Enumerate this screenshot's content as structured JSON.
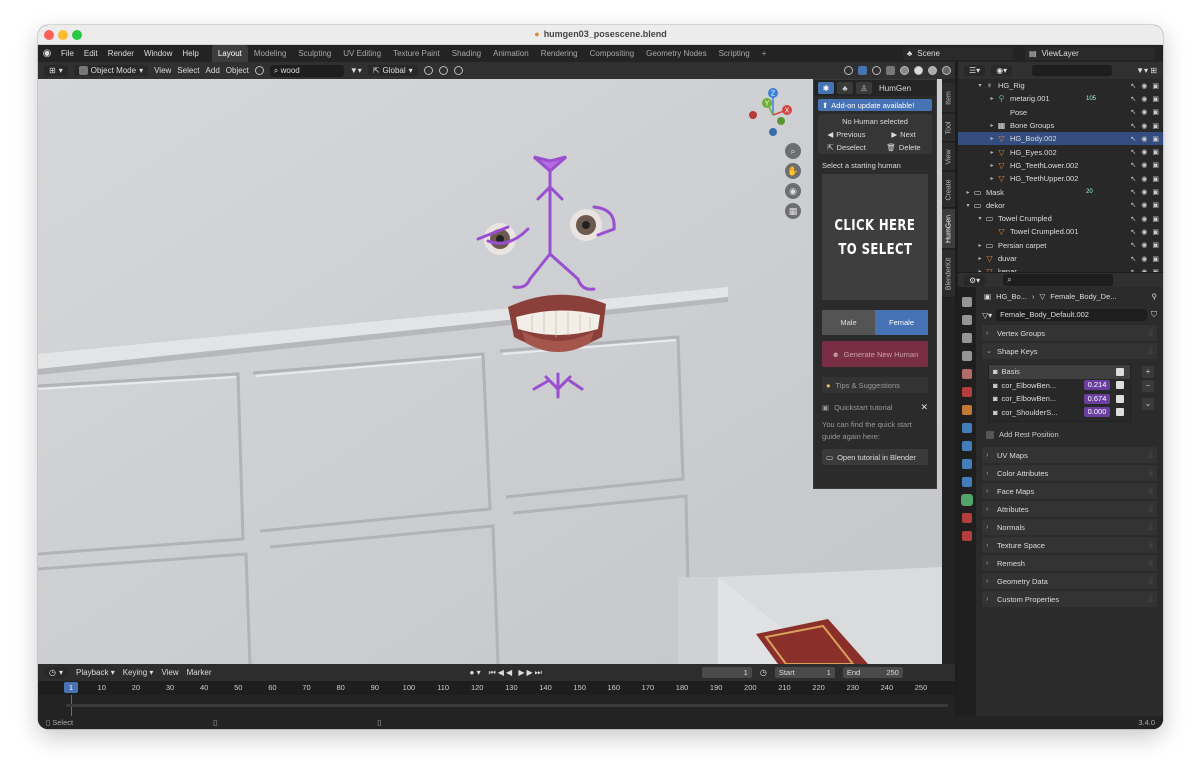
{
  "window": {
    "title": "humgen03_posescene.blend"
  },
  "menu": [
    "File",
    "Edit",
    "Render",
    "Window",
    "Help"
  ],
  "workspaces": [
    {
      "label": "Layout",
      "active": true
    },
    {
      "label": "Modeling"
    },
    {
      "label": "Sculpting"
    },
    {
      "label": "UV Editing"
    },
    {
      "label": "Texture Paint"
    },
    {
      "label": "Shading"
    },
    {
      "label": "Animation"
    },
    {
      "label": "Rendering"
    },
    {
      "label": "Compositing"
    },
    {
      "label": "Geometry Nodes"
    },
    {
      "label": "Scripting"
    },
    {
      "label": "+"
    }
  ],
  "scene": "Scene",
  "view_layer": "ViewLayer",
  "viewport_header": {
    "mode": "Object Mode",
    "items": [
      "View",
      "Select",
      "Add",
      "Object"
    ],
    "search_value": "wood",
    "transform": "Global"
  },
  "gizmo": {
    "x": "X",
    "y": "Y",
    "z": "Z"
  },
  "humgen": {
    "tab_title": "HumGen",
    "update_notice": "Add-on update available!",
    "status": "No Human selected",
    "previous": "Previous",
    "next": "Next",
    "deselect": "Deselect",
    "delete": "Delete",
    "select_label": "Select a starting human",
    "click_line1": "CLICK HERE",
    "click_line2": "TO SELECT",
    "male": "Male",
    "female": "Female",
    "generate": "Generate New Human",
    "tips": "Tips & Suggestions",
    "quickstart_title": "Quickstart tutorial",
    "quickstart_text1": "You can find the quick start",
    "quickstart_text2": "guide again here:",
    "open_tutorial": "Open tutorial in Blender"
  },
  "side_tabs": [
    "Item",
    "Tool",
    "View",
    "Create",
    "HumGen",
    "BlenderKit"
  ],
  "timeline": {
    "menus": [
      "Playback",
      "Keying",
      "View",
      "Marker"
    ],
    "current_frame": "1",
    "start_label": "Start",
    "start": "1",
    "end_label": "End",
    "end": "250",
    "ticks": [
      "1",
      "10",
      "20",
      "30",
      "40",
      "50",
      "60",
      "70",
      "80",
      "90",
      "100",
      "110",
      "120",
      "130",
      "140",
      "150",
      "160",
      "170",
      "180",
      "190",
      "200",
      "210",
      "220",
      "230",
      "240",
      "250"
    ]
  },
  "status_bar": {
    "left": "Select",
    "version": "3.4.0"
  },
  "outliner": [
    {
      "name": "HG_Rig",
      "icon": "armature-icon",
      "indent": 1,
      "arrow": "▾"
    },
    {
      "name": "metarig.001",
      "icon": "bone-icon",
      "indent": 2,
      "arrow": "▸",
      "badge": "105"
    },
    {
      "name": "Pose",
      "icon": "pose-icon",
      "indent": 2,
      "arrow": ""
    },
    {
      "name": "Bone Groups",
      "icon": "group-icon",
      "indent": 2,
      "arrow": "▸"
    },
    {
      "name": "HG_Body.002",
      "icon": "mesh-icon",
      "indent": 2,
      "arrow": "▸",
      "selected": true
    },
    {
      "name": "HG_Eyes.002",
      "icon": "mesh-icon",
      "indent": 2,
      "arrow": "▸"
    },
    {
      "name": "HG_TeethLower.002",
      "icon": "mesh-icon",
      "indent": 2,
      "arrow": "▸"
    },
    {
      "name": "HG_TeethUpper.002",
      "icon": "mesh-icon",
      "indent": 2,
      "arrow": "▸"
    },
    {
      "name": "Mask",
      "icon": "collection-icon",
      "indent": 0,
      "arrow": "▸",
      "badge": "20"
    },
    {
      "name": "dekor",
      "icon": "collection-icon",
      "indent": 0,
      "arrow": "▾"
    },
    {
      "name": "Towel Crumpled",
      "icon": "collection-icon",
      "indent": 1,
      "arrow": "▾"
    },
    {
      "name": "Towel Crumpled.001",
      "icon": "mesh-icon",
      "indent": 2,
      "arrow": ""
    },
    {
      "name": "Persian carpet",
      "icon": "collection-icon",
      "indent": 1,
      "arrow": "▸"
    },
    {
      "name": "duvar",
      "icon": "mesh-icon",
      "indent": 1,
      "arrow": "▸"
    },
    {
      "name": "kenar",
      "icon": "mesh-icon",
      "indent": 1,
      "arrow": "▸"
    }
  ],
  "properties": {
    "breadcrumb_object": "HG_Bo...",
    "breadcrumb_data": "Female_Body_De...",
    "data_name": "Female_Body_Default.002",
    "panels_top": [
      "Vertex Groups",
      "Shape Keys"
    ],
    "shape_keys": [
      {
        "name": "Basis",
        "value": ""
      },
      {
        "name": "cor_ElbowBen...",
        "value": "0.214"
      },
      {
        "name": "cor_ElbowBen...",
        "value": "0.674"
      },
      {
        "name": "cor_ShoulderS...",
        "value": "0.000"
      }
    ],
    "add_rest": "Add Rest Position",
    "panels_bottom": [
      "UV Maps",
      "Color Attributes",
      "Face Maps",
      "Attributes",
      "Normals",
      "Texture Space",
      "Remesh",
      "Geometry Data",
      "Custom Properties"
    ]
  },
  "colors": {
    "accent": "#4772b3",
    "selection": "#334d80",
    "shape_value": "#6b3fa0",
    "generate": "#7a2e45"
  }
}
